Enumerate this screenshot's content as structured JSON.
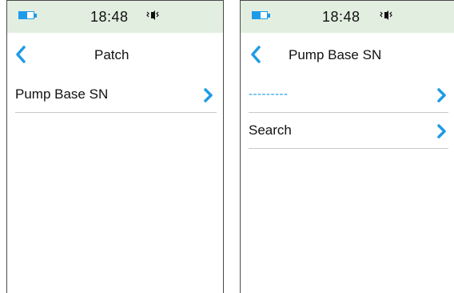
{
  "left_screen": {
    "status": {
      "time": "18:48",
      "battery_level": 0.55,
      "icons": [
        "battery-icon",
        "vibrate-icon"
      ]
    },
    "header": {
      "title": "Patch",
      "back_icon": "chevron-left-icon"
    },
    "items": [
      {
        "label": "Pump Base SN",
        "icon": "chevron-right-icon"
      }
    ]
  },
  "right_screen": {
    "status": {
      "time": "18:48",
      "battery_level": 0.55,
      "icons": [
        "battery-icon",
        "vibrate-icon"
      ]
    },
    "header": {
      "title": "Pump Base SN",
      "back_icon": "chevron-left-icon"
    },
    "items": [
      {
        "label": "---------",
        "icon": "chevron-right-icon"
      },
      {
        "label": "Search",
        "icon": "chevron-right-icon"
      }
    ]
  },
  "colors": {
    "accent": "#1e9be8",
    "status_bar": "#e2eee0",
    "divider": "#c8c8c8",
    "text": "#111111"
  }
}
